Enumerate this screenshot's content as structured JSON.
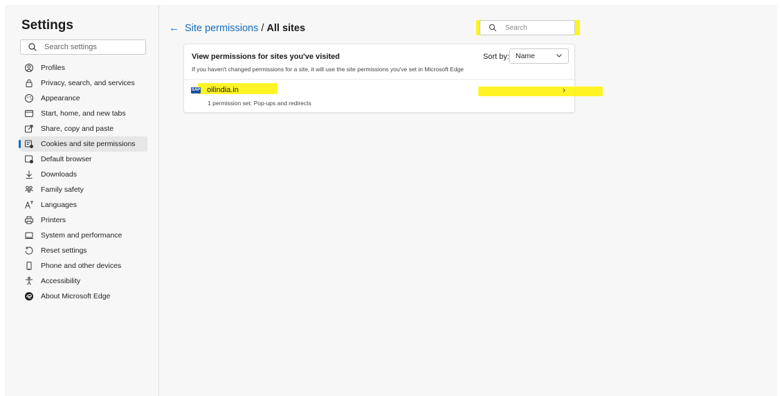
{
  "sidebar": {
    "title": "Settings",
    "search_placeholder": "Search settings",
    "items": [
      {
        "label": "Profiles",
        "icon": "profile-icon"
      },
      {
        "label": "Privacy, search, and services",
        "icon": "lock-icon"
      },
      {
        "label": "Appearance",
        "icon": "appearance-icon"
      },
      {
        "label": "Start, home, and new tabs",
        "icon": "home-tabs-icon"
      },
      {
        "label": "Share, copy and paste",
        "icon": "share-icon"
      },
      {
        "label": "Cookies and site permissions",
        "icon": "cookies-icon",
        "active": true
      },
      {
        "label": "Default browser",
        "icon": "default-browser-icon"
      },
      {
        "label": "Downloads",
        "icon": "download-icon"
      },
      {
        "label": "Family safety",
        "icon": "family-icon"
      },
      {
        "label": "Languages",
        "icon": "languages-icon"
      },
      {
        "label": "Printers",
        "icon": "printer-icon"
      },
      {
        "label": "System and performance",
        "icon": "system-icon"
      },
      {
        "label": "Reset settings",
        "icon": "reset-icon"
      },
      {
        "label": "Phone and other devices",
        "icon": "phone-icon"
      },
      {
        "label": "Accessibility",
        "icon": "accessibility-icon"
      },
      {
        "label": "About Microsoft Edge",
        "icon": "edge-logo-icon"
      }
    ]
  },
  "header": {
    "breadcrumb_link": "Site permissions",
    "separator": "/",
    "current": "All sites"
  },
  "search": {
    "placeholder": "Search"
  },
  "card": {
    "title": "View permissions for sites you've visited",
    "description": "If you haven't changed permissions for a site, it will use the site permissions you've set in Microsoft Edge",
    "sort_label": "Sort by:",
    "sort_value": "Name"
  },
  "sites": [
    {
      "name": "oilindia.in",
      "permissions": "1 permission set: Pop-ups and redirects",
      "favicon_text": "SAP"
    }
  ],
  "colors": {
    "accent": "#0f6cbd",
    "highlight": "#fff200"
  }
}
